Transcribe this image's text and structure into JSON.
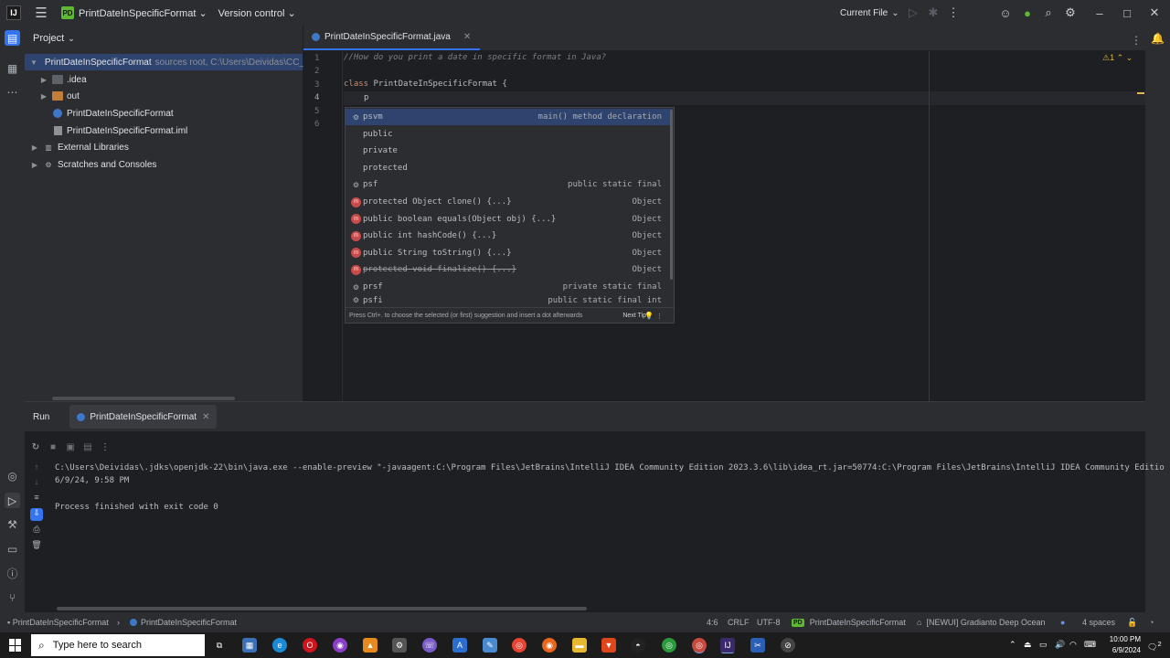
{
  "titlebar": {
    "project_badge": "PD",
    "project_name": "PrintDateInSpecificFormat",
    "vcs_label": "Version control",
    "run_config": "Current File"
  },
  "project_panel": {
    "header": "Project",
    "tree": [
      {
        "label": "PrintDateInSpecificFormat",
        "sub": "sources root,  C:\\Users\\Deividas\\CC_W",
        "selected": true
      },
      {
        "label": ".idea"
      },
      {
        "label": "out"
      },
      {
        "label": "PrintDateInSpecificFormat"
      },
      {
        "label": "PrintDateInSpecificFormat.iml"
      },
      {
        "label": "External Libraries"
      },
      {
        "label": "Scratches and Consoles"
      }
    ]
  },
  "editor": {
    "tab": "PrintDateInSpecificFormat.java",
    "warning_count": "1",
    "line_numbers": [
      "1",
      "2",
      "3",
      "4",
      "5",
      "6"
    ],
    "comment": "//How do you print a date in specific format in Java?",
    "class_kw": "class",
    "class_name": "PrintDateInSpecificFormat",
    "open_brace": " {",
    "typed": "p"
  },
  "completion": {
    "items": [
      {
        "text": "psvm",
        "type": "main() method declaration",
        "icon": "live-template-icon"
      },
      {
        "text": "public",
        "type": ""
      },
      {
        "text": "private",
        "type": ""
      },
      {
        "text": "protected",
        "type": ""
      },
      {
        "text": "psf",
        "type": "public static final",
        "icon": "live-template-icon"
      },
      {
        "text": "protected Object clone() {...}",
        "type": "Object",
        "icon": "method-icon"
      },
      {
        "text": "public boolean equals(Object obj) {...}",
        "type": "Object",
        "icon": "method-icon"
      },
      {
        "text": "public int hashCode() {...}",
        "type": "Object",
        "icon": "method-icon"
      },
      {
        "text": "public String toString() {...}",
        "type": "Object",
        "icon": "method-icon"
      },
      {
        "text": "protected void finalize() {...}",
        "type": "Object",
        "icon": "method-icon",
        "deprecated": true
      },
      {
        "text": "prsf",
        "type": "private static final",
        "icon": "live-template-icon"
      },
      {
        "text": "psfi",
        "type": "public static final int",
        "icon": "live-template-icon"
      }
    ],
    "footer_hint": "Press Ctrl+. to choose the selected (or first) suggestion and insert a dot afterwards",
    "next_tip": "Next Tip"
  },
  "run_panel": {
    "label": "Run",
    "tab": "PrintDateInSpecificFormat",
    "output": [
      "C:\\Users\\Deividas\\.jdks\\openjdk-22\\bin\\java.exe --enable-preview \"-javaagent:C:\\Program Files\\JetBrains\\IntelliJ IDEA Community Edition 2023.3.6\\lib\\idea_rt.jar=50774:C:\\Program Files\\JetBrains\\IntelliJ IDEA Community Editio",
      "6/9/24, 9:58 PM",
      "",
      "Process finished with exit code 0"
    ]
  },
  "statusbar": {
    "crumb_project": "PrintDateInSpecificFormat",
    "crumb_class": "PrintDateInSpecificFormat",
    "position": "4:6",
    "line_sep": "CRLF",
    "encoding": "UTF-8",
    "module_badge": "PD",
    "module": "PrintDateInSpecificFormat",
    "theme": "[NEWUI] Gradianto Deep Ocean",
    "indent": "4 spaces"
  },
  "taskbar": {
    "search_placeholder": "Type here to search",
    "time": "10:00 PM",
    "date": "6/9/2024",
    "notif_count": "2"
  }
}
